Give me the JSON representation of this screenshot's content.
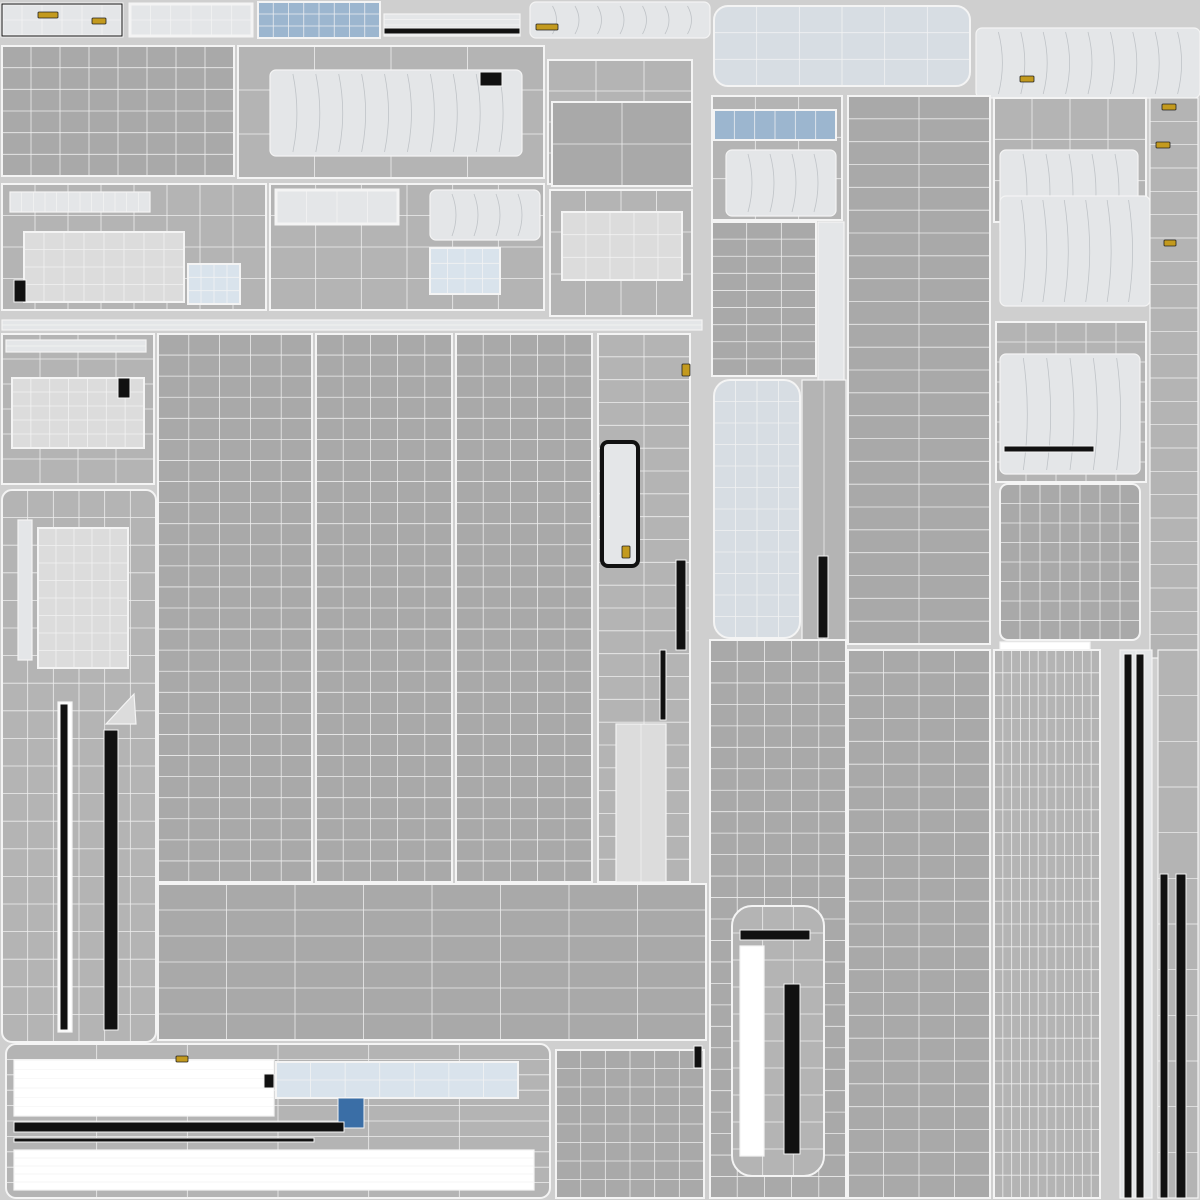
{
  "atlas": {
    "colors": {
      "background": "#cfcfcf",
      "panel_fill": "#a9a9a9",
      "panel_fill_light": "#b4b4b4",
      "wire": "#f4f4f4",
      "glass": "#9cb6cf",
      "glass_dark": "#3a6ea6",
      "dark_part": "#111111",
      "accent_part": "#c39a1e",
      "detail_fill": "#e4e6e8"
    }
  }
}
